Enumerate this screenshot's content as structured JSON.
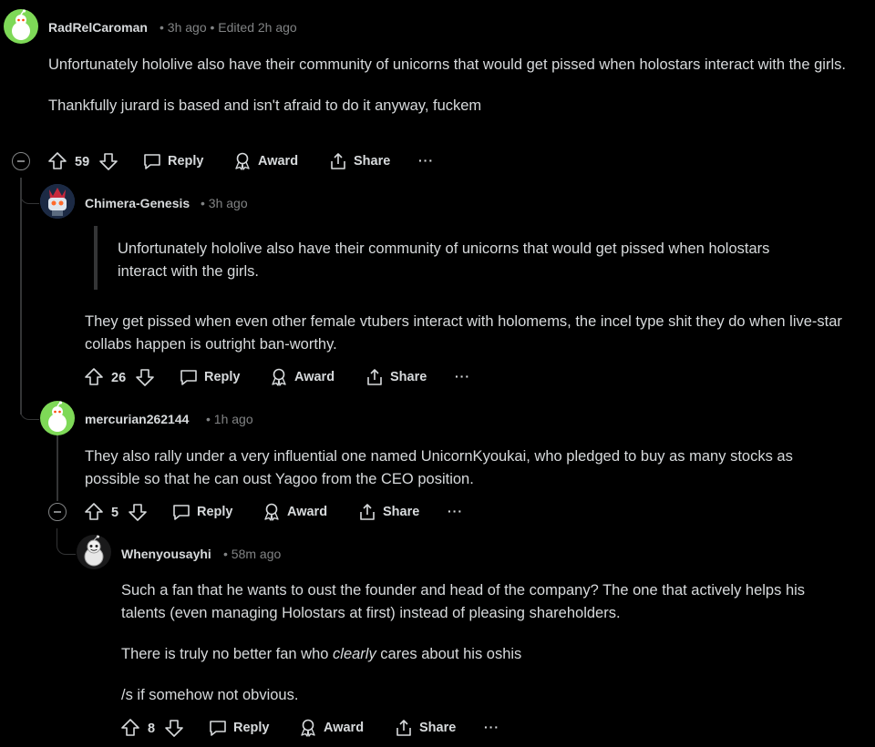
{
  "comments": [
    {
      "author": "RadRelCaroman",
      "meta": "• 3h ago • Edited 2h ago",
      "paragraphs": [
        "Unfortunately hololive also have their community of unicorns that would get pissed when holostars interact with the girls.",
        "Thankfully jurard is based and isn't afraid to do it anyway, fuckem"
      ],
      "votes": "59",
      "actions": {
        "reply": "Reply",
        "award": "Award",
        "share": "Share",
        "more": "···"
      }
    },
    {
      "author": "Chimera-Genesis",
      "meta": "• 3h ago",
      "quote": "Unfortunately hololive also have their community of unicorns that would get pissed when holostars interact with the girls.",
      "paragraphs": [
        "They get pissed when even other female vtubers interact with holomems, the incel type shit they do when live-star collabs happen is outright ban-worthy."
      ],
      "votes": "26",
      "actions": {
        "reply": "Reply",
        "award": "Award",
        "share": "Share",
        "more": "···"
      }
    },
    {
      "author": "mercurian262144",
      "meta": "• 1h ago",
      "paragraphs": [
        "They also rally under a very influential one named UnicornKyoukai, who pledged to buy as many stocks as possible so that he can oust Yagoo from the CEO position."
      ],
      "votes": "5",
      "actions": {
        "reply": "Reply",
        "award": "Award",
        "share": "Share",
        "more": "···"
      }
    },
    {
      "author": "Whenyousayhi",
      "meta": "• 58m ago",
      "paragraphs": [
        "Such a fan that he wants to oust the founder and head of the company? The one that actively helps his talents (even managing Holostars at first) instead of pleasing shareholders."
      ],
      "p2_before": "There is truly no better fan who ",
      "p2_em": "clearly",
      "p2_after": " cares about his oshis",
      "p3": "/s if somehow not obvious.",
      "votes": "8",
      "actions": {
        "reply": "Reply",
        "award": "Award",
        "share": "Share",
        "more": "···"
      }
    }
  ],
  "colors": {
    "background": "#000000",
    "text": "#d7dadc",
    "muted": "#818384",
    "thread": "#343536",
    "avatar_green": "#7ed957"
  }
}
